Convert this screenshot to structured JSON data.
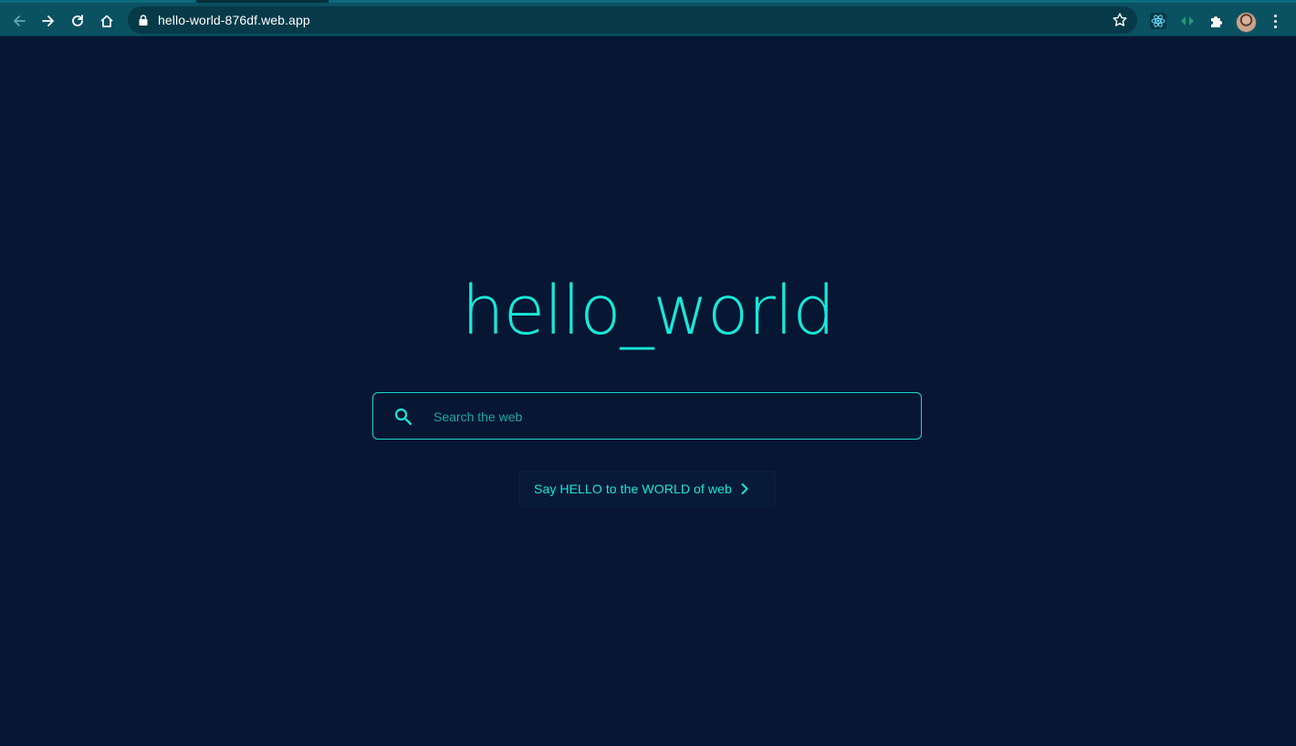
{
  "browser": {
    "url": "hello-world-876df.web.app"
  },
  "page": {
    "title": "hello_world",
    "search": {
      "placeholder": "Search the web",
      "value": ""
    },
    "cta_label": "Say HELLO to the WORLD of web"
  },
  "colors": {
    "background": "#061633",
    "accent": "#17e8d8",
    "toolbar": "#0a5161"
  }
}
